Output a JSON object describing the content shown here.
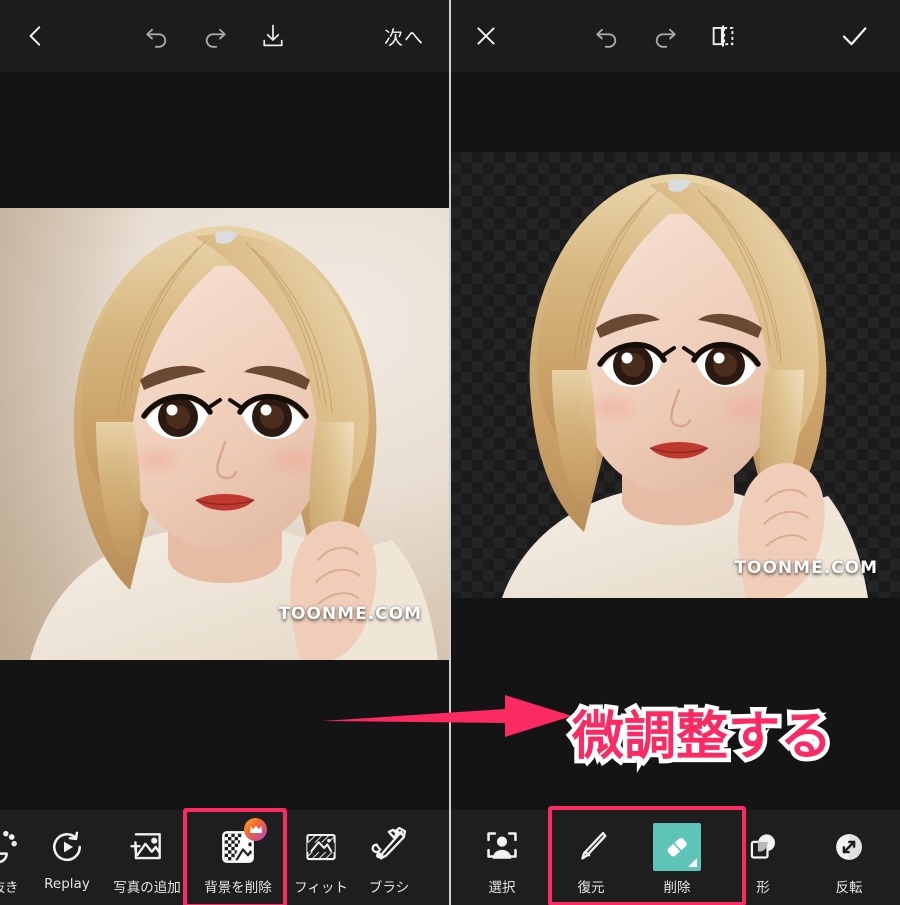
{
  "left_panel": {
    "topbar": {
      "back_icon": "chevron-left-icon",
      "undo_icon": "undo-icon",
      "redo_icon": "redo-icon",
      "download_icon": "download-icon",
      "next_label": "次へ"
    },
    "photo": {
      "watermark": "TOONME.COM"
    },
    "toolbar": {
      "items": [
        {
          "label": "抜き",
          "icon": "cutout-icon",
          "highlighted": false,
          "truncated": true
        },
        {
          "label": "Replay",
          "icon": "replay-icon",
          "highlighted": false
        },
        {
          "label": "写真の追加",
          "icon": "add-photo-icon",
          "highlighted": false
        },
        {
          "label": "背景を削除",
          "icon": "remove-bg-icon",
          "highlighted": true,
          "badge": "crown-icon"
        },
        {
          "label": "フィット",
          "icon": "fit-icon",
          "highlighted": false
        },
        {
          "label": "ブラシ",
          "icon": "brush-icon",
          "highlighted": false
        }
      ]
    }
  },
  "right_panel": {
    "topbar": {
      "close_icon": "close-icon",
      "undo_icon": "undo-icon",
      "redo_icon": "redo-icon",
      "compare_icon": "compare-split-icon",
      "confirm_icon": "check-icon"
    },
    "photo": {
      "watermark": "TOONME.COM",
      "background": "transparent-checkerboard"
    },
    "toolbar": {
      "items": [
        {
          "label": "選択",
          "icon": "select-subject-icon",
          "highlighted": false,
          "selected": false
        },
        {
          "label": "復元",
          "icon": "restore-brush-icon",
          "highlighted": true,
          "selected": false
        },
        {
          "label": "削除",
          "icon": "eraser-icon",
          "highlighted": true,
          "selected": true
        },
        {
          "label": "形",
          "icon": "shape-icon",
          "highlighted": false,
          "selected": false
        },
        {
          "label": "反転",
          "icon": "invert-icon",
          "highlighted": false,
          "selected": false
        }
      ]
    }
  },
  "annotation": {
    "arrow_icon": "right-arrow-annotation",
    "text": "微調整する"
  },
  "colors": {
    "accent_pink": "#fb2a63",
    "selected_teal": "#5fc4b8",
    "bar_background": "#1c1c1c",
    "toolbar_background": "#1e1e1e",
    "canvas_background": "#141414"
  }
}
